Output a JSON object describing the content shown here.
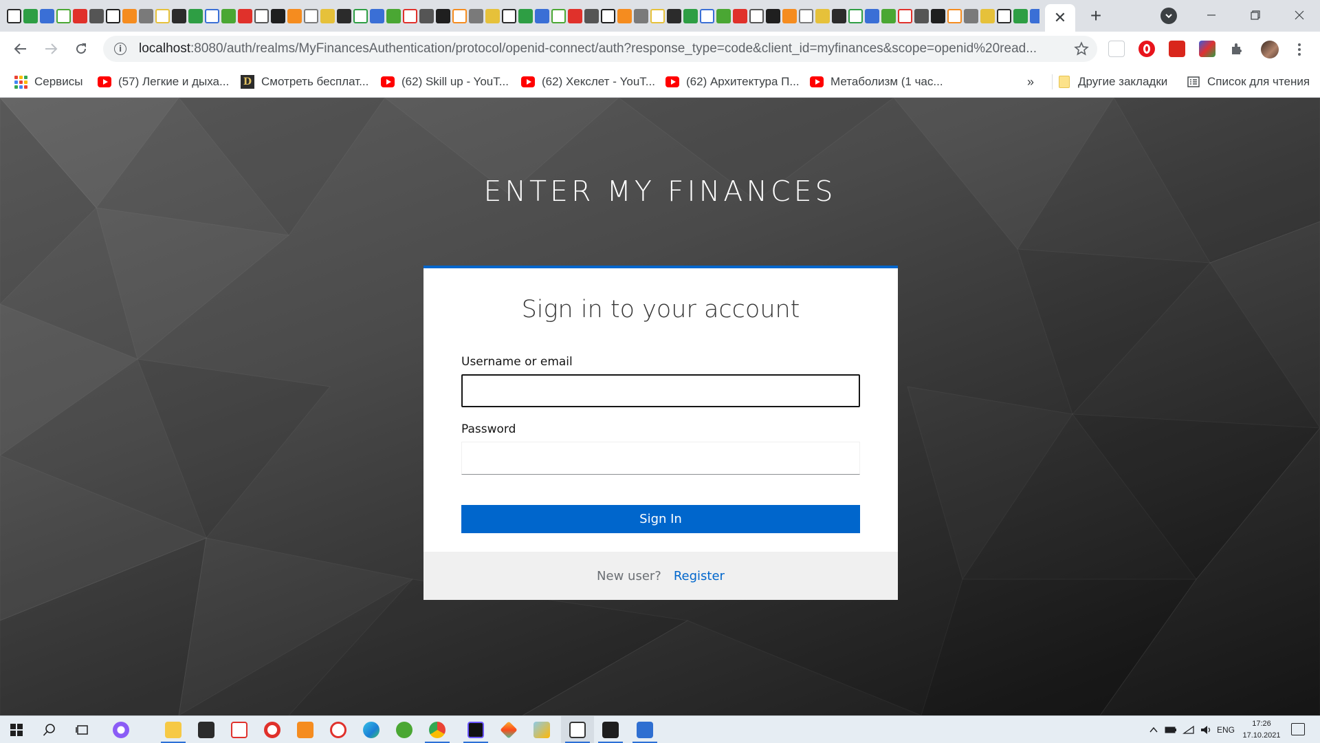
{
  "browser": {
    "tab_favicon_count": 70,
    "active_tab_close": "✕",
    "new_tab": "+",
    "address_bar": {
      "host": "localhost",
      "rest": ":8080/auth/realms/MyFinancesAuthentication/protocol/openid-connect/auth?response_type=code&client_id=myfinances&scope=openid%20read..."
    },
    "bookmarks": [
      {
        "label": "Сервисы",
        "icon": "apps-grid-icon"
      },
      {
        "label": "(57) Легкие и дыха...",
        "icon": "youtube-icon"
      },
      {
        "label": "Смотреть бесплат...",
        "icon": "d-logo-icon"
      },
      {
        "label": "(62) Skill up - YouT...",
        "icon": "youtube-icon"
      },
      {
        "label": "(62) Хекслет - YouT...",
        "icon": "youtube-icon"
      },
      {
        "label": "(62) Архитектура П...",
        "icon": "youtube-icon"
      },
      {
        "label": "Метаболизм (1 час...",
        "icon": "youtube-icon"
      }
    ],
    "bookmarks_overflow": "»",
    "other_bookmarks": "Другие закладки",
    "reading_list": "Список для чтения"
  },
  "login": {
    "header": "ENTER MY FINANCES",
    "title": "Sign in to your account",
    "username_label": "Username or email",
    "username_value": "",
    "password_label": "Password",
    "password_value": "",
    "submit_label": "Sign In",
    "footer_text": "New user?",
    "register_label": "Register"
  },
  "taskbar": {
    "language": "ENG",
    "time": "17:26",
    "date": "17.10.2021"
  },
  "colors": {
    "accent": "#0066cc",
    "card_footer": "#f0f0f0",
    "tab_strip": "#dee1e6",
    "taskbar": "#e6edf3"
  }
}
